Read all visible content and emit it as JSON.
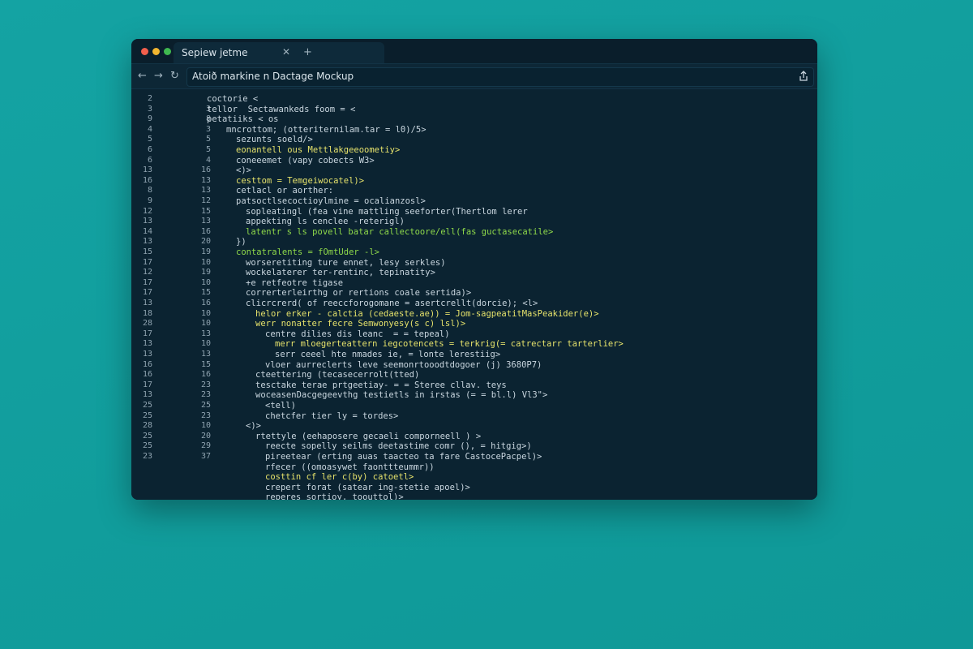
{
  "colors": {
    "traffic_red": "#f25f4c",
    "traffic_yellow": "#f2b630",
    "traffic_green": "#3fb950",
    "accent_yellow": "#e6e26b",
    "accent_green": "#8fd94a",
    "accent_blue": "#7fb7e6"
  },
  "tab": {
    "title": "Sepiew jetme",
    "close_glyph": "✕",
    "new_tab_glyph": "+"
  },
  "toolbar": {
    "back_glyph": "←",
    "forward_glyph": "→",
    "reload_glyph": "↻",
    "url": "Atoið markine n Dactage Mockup"
  },
  "gutter_left": [
    "2",
    "3",
    "9",
    "4",
    "5",
    "6",
    "6",
    "13",
    "16",
    "8",
    "9",
    "12",
    "13",
    "14",
    "13",
    "15",
    "17",
    "12",
    "17",
    "17",
    "13",
    "18",
    "28",
    "17",
    "13",
    "13",
    "16",
    "16",
    "17",
    "13",
    "25",
    "25",
    "28",
    "25",
    "25",
    "23"
  ],
  "gutter_right": [
    "3",
    "8",
    "3",
    "5",
    "5",
    "4",
    "16",
    "13",
    "13",
    "12",
    "15",
    "13",
    "16",
    "20",
    "19",
    "10",
    "19",
    "10",
    "15",
    "16",
    "10",
    "10",
    "13",
    "10",
    "13",
    "15",
    "16",
    "23",
    "23",
    "25",
    "23",
    "10",
    "20",
    "29",
    "37"
  ],
  "code_lines": [
    {
      "text": "coctorie <",
      "indent": 0,
      "tone": "plain"
    },
    {
      "text": "tellor  Sectawankeds foom = <",
      "indent": 0,
      "tone": "plain"
    },
    {
      "text": "petatiiks < os",
      "indent": 0,
      "tone": "plain"
    },
    {
      "text": "mncrottom; (otteriternilam.tar = l0)/5>",
      "indent": 2,
      "tone": "plain"
    },
    {
      "text": "sezunts soeld/>",
      "indent": 3,
      "tone": "plain"
    },
    {
      "text": "eonantell ous Mettlakgeeoometiy>",
      "indent": 3,
      "tone": "yellow"
    },
    {
      "text": "coneeemet (vapy cobects W3>",
      "indent": 3,
      "tone": "plain"
    },
    {
      "text": "<)>",
      "indent": 3,
      "tone": "plain"
    },
    {
      "text": "cesttom = Temgeiwocatel)>",
      "indent": 3,
      "tone": "yellow"
    },
    {
      "text": "cetlacl or aorther:",
      "indent": 3,
      "tone": "plain"
    },
    {
      "text": "patsoctlsecoctioylmine = ocalianzosl>",
      "indent": 3,
      "tone": "plain"
    },
    {
      "text": "sopleatingl (fea vine mattling seeforter(Thertlom lerer",
      "indent": 4,
      "tone": "plain"
    },
    {
      "text": "appekting ls cenclee -reterigl)",
      "indent": 4,
      "tone": "plain"
    },
    {
      "text": "latentr s ls povell batar callectoore/ell(fas guctasecatile>",
      "indent": 4,
      "tone": "green"
    },
    {
      "text": "})",
      "indent": 3,
      "tone": "plain"
    },
    {
      "text": "contatralents = fOmtUder -l>",
      "indent": 3,
      "tone": "green"
    },
    {
      "text": "worseretiting ture ennet, lesy serkles)",
      "indent": 4,
      "tone": "plain"
    },
    {
      "text": "wockelaterer ter-rentinc, tepinatity>",
      "indent": 4,
      "tone": "plain"
    },
    {
      "text": "+e retfeotre tigase",
      "indent": 4,
      "tone": "plain"
    },
    {
      "text": "correrterleirthg or rertions coale sertida)>",
      "indent": 4,
      "tone": "plain"
    },
    {
      "text": "clicrcrerd( of reeccforogomane = asertcrellt(dorcie); <l>",
      "indent": 4,
      "tone": "plain"
    },
    {
      "text": "helor erker - calctia (cedaeste.ae)) = Jom-sagpeatitMasPeakider(e)>",
      "indent": 5,
      "tone": "yellow"
    },
    {
      "text": "werr nonatter fecre Semwonyesy(s c) lsl)>",
      "indent": 5,
      "tone": "yellow"
    },
    {
      "text": "centre dilies dis leanc  = = tepeal)",
      "indent": 6,
      "tone": "plain"
    },
    {
      "text": "merr mloegerteattern iegcotencets = terkrig(= catrectarr tarterlier>",
      "indent": 7,
      "tone": "yellow"
    },
    {
      "text": "serr ceeel hte nmades ie, = lonte lerestiig>",
      "indent": 7,
      "tone": "plain"
    },
    {
      "text": "vloer aurreclerts leve seemonrtooodtdogoer (j) 3680P7)",
      "indent": 6,
      "tone": "plain"
    },
    {
      "text": "cteettering (tecasecerrolt(tted)",
      "indent": 5,
      "tone": "plain"
    },
    {
      "text": "tesctake terae prtgeetiay- = = Steree cllav. teys",
      "indent": 5,
      "tone": "plain"
    },
    {
      "text": "woceasenDacgegeevthg testietls in irstas (= = bl.l) Vl3\">",
      "indent": 5,
      "tone": "plain"
    },
    {
      "text": "<tell)",
      "indent": 6,
      "tone": "plain"
    },
    {
      "text": "chetcfer tier ly = tordes>",
      "indent": 6,
      "tone": "plain"
    },
    {
      "text": "<)>",
      "indent": 4,
      "tone": "plain"
    },
    {
      "text": "rtettyle (eehaposere gecaeli comporneell ) >",
      "indent": 5,
      "tone": "plain"
    },
    {
      "text": "reecte sopelly seilms deetastime comr (), = hitgig>)",
      "indent": 6,
      "tone": "plain"
    },
    {
      "text": "pireetear (erting auas taacteo ta fare CastocePacpel)>",
      "indent": 6,
      "tone": "plain"
    },
    {
      "text": "rfecer ((omoasywet faonttteummr))",
      "indent": 6,
      "tone": "plain"
    },
    {
      "text": "costtin cf ler c(by) catoetl>",
      "indent": 6,
      "tone": "yellow"
    },
    {
      "text": "crepert forat (satear ing-stetie apoel)>",
      "indent": 6,
      "tone": "plain"
    },
    {
      "text": "reperes sortioy, toouttol)>",
      "indent": 6,
      "tone": "plain"
    }
  ]
}
